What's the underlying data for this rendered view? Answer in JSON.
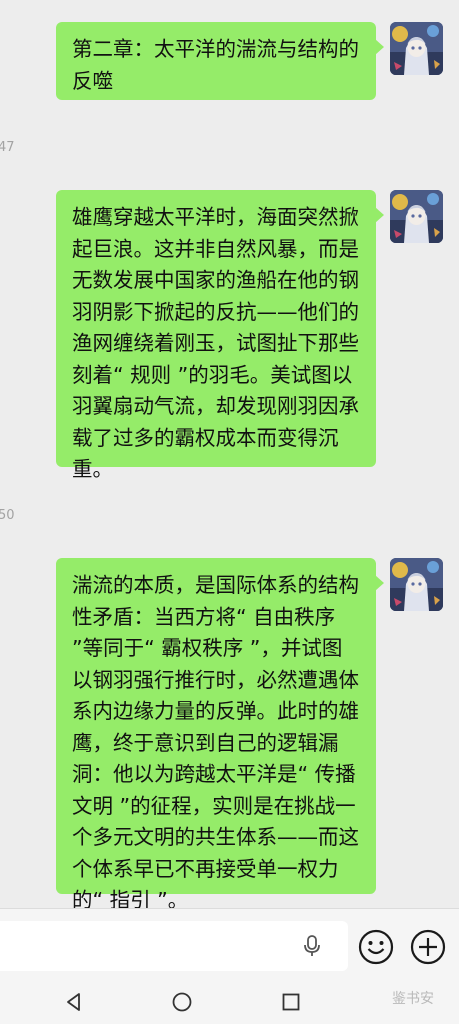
{
  "chat": {
    "messages": [
      {
        "text": "第二章：太平洋的湍流与结构的反噬"
      },
      {
        "text": "雄鹰穿越太平洋时，海面突然掀起巨浪。这并非自然风暴，而是无数发展中国家的渔船在他的钢羽阴影下掀起的反抗——他们的渔网缠绕着刚玉，试图扯下那些刻着“ 规则 ”的羽毛。美试图以羽翼扇动气流，却发现刚羽因承载了过多的霸权成本而变得沉重。"
      },
      {
        "text": "湍流的本质，是国际体系的结构性矛盾：当西方将“ 自由秩序 ”等同于“ 霸权秩序 ”，并试图以钢羽强行推行时，必然遭遇体系内边缘力量的反弹。此时的雄鹰，终于意识到自己的逻辑漏洞：他以为跨越太平洋是“ 传播文明 ”的征程，实则是在挑战一个多元文明的共生体系——而这个体系早已不再接受单一权力的“ 指引 ”。"
      }
    ],
    "time_fragments": [
      "47",
      "50"
    ]
  },
  "colors": {
    "bubble": "#95ec69",
    "background": "#ededed"
  },
  "icons": {
    "input": [
      "mic-icon",
      "emoji-icon",
      "plus-icon"
    ],
    "nav": [
      "back-triangle-icon",
      "home-circle-icon",
      "recents-square-icon"
    ]
  },
  "watermark": "鉴书安"
}
